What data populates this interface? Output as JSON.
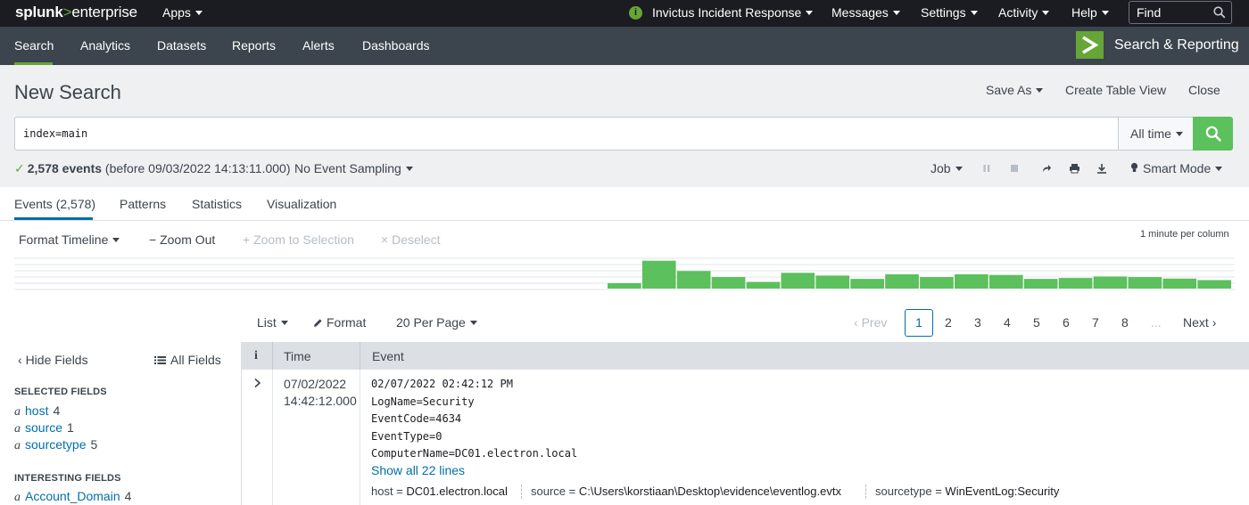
{
  "topbar": {
    "logo": {
      "brand": "splunk",
      "gt": ">",
      "product": "enterprise"
    },
    "apps_label": "Apps",
    "info_glyph": "i",
    "instance_label": "Invictus Incident Response",
    "messages_label": "Messages",
    "settings_label": "Settings",
    "activity_label": "Activity",
    "help_label": "Help",
    "find_placeholder": "Find"
  },
  "appbar": {
    "nav": [
      "Search",
      "Analytics",
      "Datasets",
      "Reports",
      "Alerts",
      "Dashboards"
    ],
    "app_name": "Search & Reporting",
    "accent_color": "#65a637"
  },
  "header": {
    "title": "New Search",
    "save_as": "Save As",
    "create_table_view": "Create Table View",
    "close": "Close",
    "query": "index=main",
    "time_range": "All time",
    "status_check": "✓",
    "event_count": "2,578 events",
    "status_suffix": "(before 09/03/2022 14:13:11.000)",
    "sampling": "No Event Sampling",
    "job_label": "Job",
    "mode": "Smart Mode",
    "search_button_color": "#5cc05c"
  },
  "tabs": [
    "Events (2,578)",
    "Patterns",
    "Statistics",
    "Visualization"
  ],
  "timeline": {
    "format_timeline": "Format Timeline",
    "zoom_out": "Zoom Out",
    "zoom_to_selection": "Zoom to Selection",
    "deselect": "Deselect",
    "scale_label": "1 minute per column",
    "bar_color": "#5cc05c",
    "bars": [
      0.18,
      0.92,
      0.58,
      0.38,
      0.22,
      0.52,
      0.43,
      0.32,
      0.47,
      0.38,
      0.47,
      0.45,
      0.32,
      0.35,
      0.4,
      0.38,
      0.33,
      0.28
    ]
  },
  "results_toolbar": {
    "list_label": "List",
    "format_label": "Format",
    "per_page": "20 Per Page",
    "prev": "Prev",
    "pages": [
      "1",
      "2",
      "3",
      "4",
      "5",
      "6",
      "7",
      "8"
    ],
    "ellipsis": "...",
    "next": "Next",
    "current_page": "1"
  },
  "sidebar": {
    "hide_fields": "Hide Fields",
    "all_fields": "All Fields",
    "selected_heading": "SELECTED FIELDS",
    "selected_fields": [
      {
        "type": "a",
        "name": "host",
        "count": "4"
      },
      {
        "type": "a",
        "name": "source",
        "count": "1"
      },
      {
        "type": "a",
        "name": "sourcetype",
        "count": "5"
      }
    ],
    "interesting_heading": "INTERESTING FIELDS",
    "interesting_fields": [
      {
        "type": "a",
        "name": "Account_Domain",
        "count": "4"
      }
    ]
  },
  "table": {
    "col_info": "i",
    "col_time": "Time",
    "col_event": "Event",
    "event": {
      "date": "07/02/2022",
      "time": "14:42:12.000",
      "lines": [
        "02/07/2022 02:42:12 PM",
        "LogName=Security",
        "EventCode=4634",
        "EventType=0",
        "ComputerName=DC01.electron.local"
      ],
      "show_all": "Show all 22 lines",
      "kv": [
        {
          "key": "host =",
          "value": "DC01.electron.local"
        },
        {
          "key": "source =",
          "value": "C:\\Users\\korstiaan\\Desktop\\evidence\\eventlog.evtx"
        },
        {
          "key": "sourcetype =",
          "value": "WinEventLog:Security"
        }
      ]
    }
  }
}
